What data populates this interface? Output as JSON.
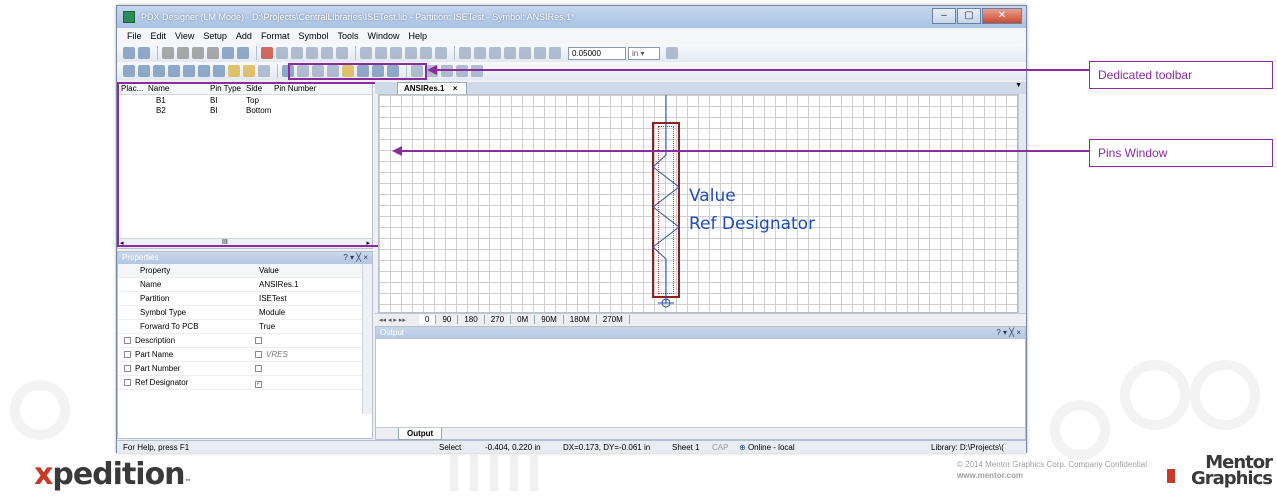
{
  "window": {
    "title": "PDX Designer (LM Mode) - D:\\Projects\\CentralLibraries\\ISETest.lib - Partition: ISETest - Symbol: ANSIRes.1*"
  },
  "menu": [
    "File",
    "Edit",
    "View",
    "Setup",
    "Add",
    "Format",
    "Symbol",
    "Tools",
    "Window",
    "Help"
  ],
  "toolbar": {
    "grid_value": "0.05000",
    "unit": "in"
  },
  "pins": {
    "headers": [
      "Plac...",
      "Name",
      "Pin Type",
      "Side",
      "Pin Number"
    ],
    "rows": [
      {
        "name": "B1",
        "type": "BI",
        "side": "Top",
        "number": ""
      },
      {
        "name": "B2",
        "type": "BI",
        "side": "Bottom",
        "number": ""
      }
    ],
    "scroll_marker": "III"
  },
  "properties": {
    "title": "Properties",
    "controls": "? ▾ ╳ ×",
    "headers": [
      "Property",
      "Value"
    ],
    "rows": [
      {
        "key": "Name",
        "value": "ANSIRes.1"
      },
      {
        "key": "Partition",
        "value": "ISETest"
      },
      {
        "key": "Symbol Type",
        "value": "Module"
      },
      {
        "key": "Forward To PCB",
        "value": "True"
      }
    ],
    "check_rows": [
      {
        "key": "Description",
        "value": "",
        "checked": false
      },
      {
        "key": "Part Name",
        "value": "VRES",
        "checked": false
      },
      {
        "key": "Part Number",
        "value": "",
        "checked": false
      },
      {
        "key": "Ref Designator",
        "value": "",
        "checked": true
      }
    ]
  },
  "document": {
    "tab": "ANSIRes.1",
    "symbol_labels": {
      "value": "Value",
      "ref": "Ref Designator"
    },
    "view_tabs": [
      "0",
      "90",
      "180",
      "270",
      "0M",
      "90M",
      "180M",
      "270M"
    ],
    "nav": "◂◂ ◂ ▸ ▸▸"
  },
  "output": {
    "title": "Output",
    "controls": "? ▾ ╳ ×",
    "tab": "Output"
  },
  "status": {
    "help": "For Help, press F1",
    "mode": "Select",
    "coords": "-0.404, 0.220 in",
    "delta": "DX=0.173, DY=-0.061 in",
    "sheet": "Sheet 1",
    "cap": "CAP",
    "online": "Online - local",
    "library": "Library: D:\\Projects\\("
  },
  "callouts": {
    "toolbar": "Dedicated toolbar",
    "pins": "Pins Window"
  },
  "footer": {
    "brand_x": "x",
    "brand_rest": "pedition",
    "brand_tm": "™",
    "copyright": "© 2014 Mentor Graphics Corp.   Company Confidential",
    "url": "www.mentor.com",
    "mg_line1": "Mentor",
    "mg_line2": "Graphics"
  },
  "colors": {
    "callout": "#8a2b9e",
    "symbol_outline": "#8b2222",
    "label_blue": "#1f4db5"
  }
}
